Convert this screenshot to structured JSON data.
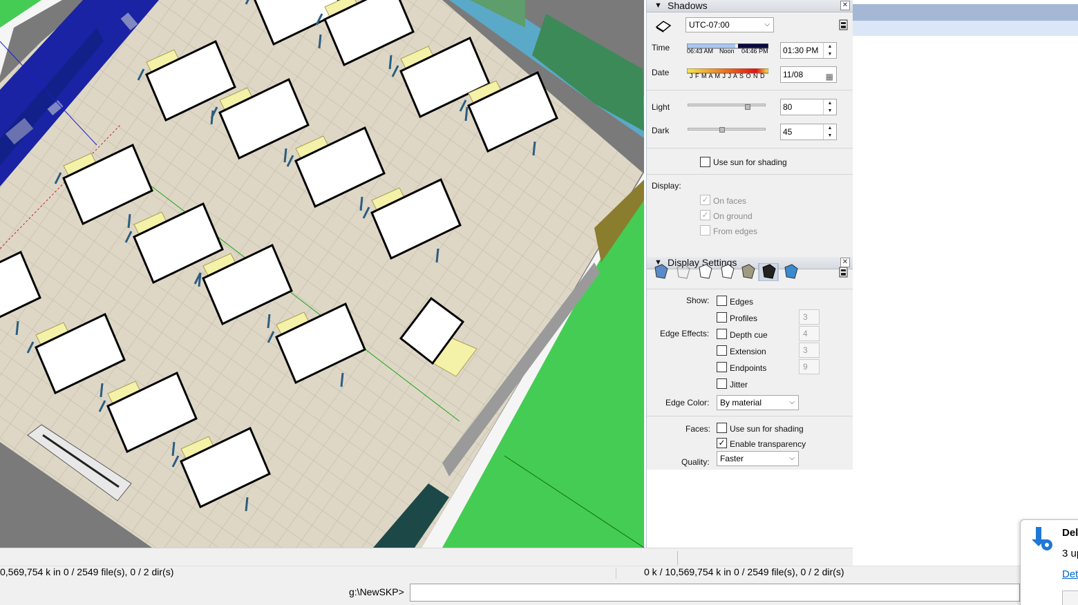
{
  "shadows": {
    "title": "Shadows",
    "timezone": "UTC-07:00",
    "time_label": "Time",
    "date_label": "Date",
    "sunrise": "06:43 AM",
    "noon": "Noon",
    "sunset": "04:46 PM",
    "months": "J F M A M J J A S O N D",
    "time_value": "01:30 PM",
    "date_value": "11/08",
    "light_label": "Light",
    "light_value": "80",
    "dark_label": "Dark",
    "dark_value": "45",
    "use_sun_label": "Use sun for shading",
    "display_label": "Display:",
    "on_faces": "On faces",
    "on_ground": "On ground",
    "from_edges": "From edges"
  },
  "display_settings": {
    "title": "Display Settings",
    "show_label": "Show:",
    "edge_effects_label": "Edge Effects:",
    "edges": "Edges",
    "profiles": "Profiles",
    "profiles_val": "3",
    "depth_cue": "Depth cue",
    "depth_cue_val": "4",
    "extension": "Extension",
    "extension_val": "3",
    "endpoints": "Endpoints",
    "endpoints_val": "9",
    "jitter": "Jitter",
    "edge_color_label": "Edge Color:",
    "edge_color_value": "By material",
    "faces_label": "Faces:",
    "faces_use_sun": "Use sun for shading",
    "enable_transparency": "Enable transparency",
    "quality_label": "Quality:",
    "quality_value": "Faster"
  },
  "status": {
    "left_text": "0,569,754 k in 0 / 2549 file(s), 0 / 2 dir(s)",
    "right_text": "0 k / 10,569,754 k in 0 / 2549 file(s), 0 / 2 dir(s)",
    "prompt": "g:\\NewSKP>"
  },
  "notification": {
    "title": "Del",
    "line": "3 up",
    "link": "Det"
  },
  "colors": {
    "grass": "#45cc54",
    "floor": "#ddd6c4",
    "wall": "#7a7a7a",
    "accent_link": "#0066cc"
  }
}
